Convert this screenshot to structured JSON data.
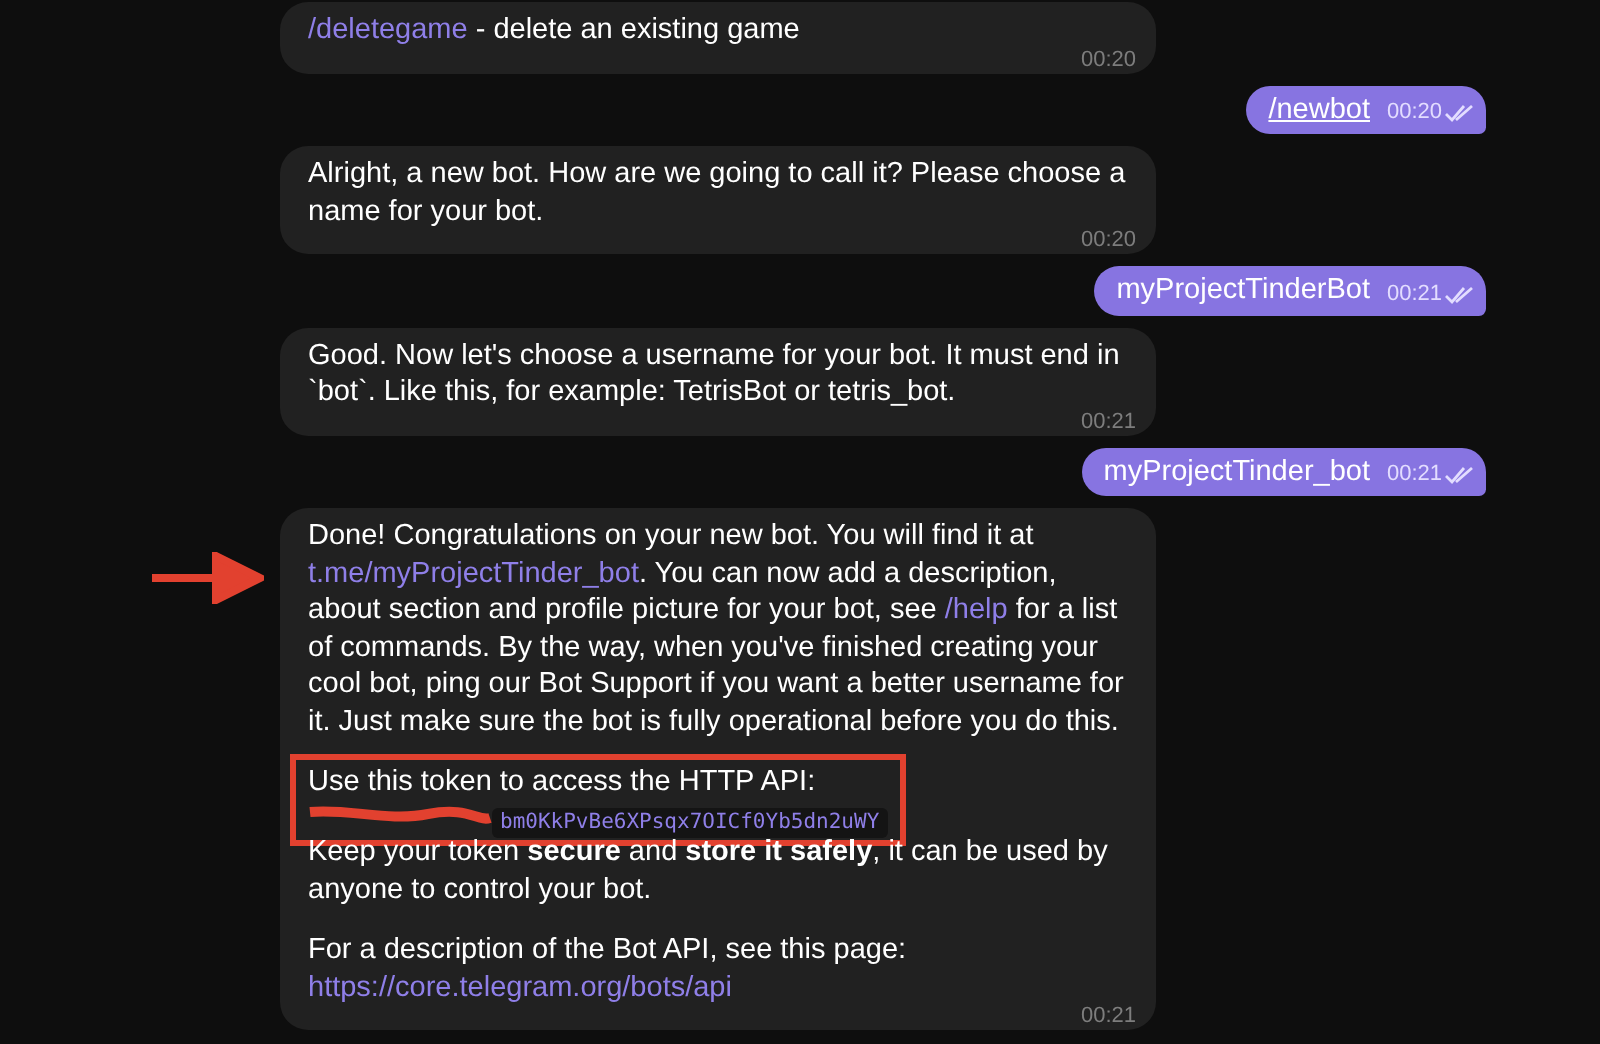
{
  "messages": [
    {
      "kind": "incoming",
      "time": "00:20",
      "paragraphs": [
        {
          "segments": [
            {
              "kind": "link",
              "text": "/deletegame"
            },
            {
              "kind": "text",
              "text": " - delete an existing game"
            }
          ]
        }
      ]
    },
    {
      "kind": "outgoing",
      "time": "00:20",
      "read": true,
      "paragraphs": [
        {
          "segments": [
            {
              "kind": "link",
              "text": "/newbot"
            }
          ]
        }
      ]
    },
    {
      "kind": "incoming",
      "time": "00:20",
      "paragraphs": [
        {
          "segments": [
            {
              "kind": "text",
              "text": "Alright, a new bot. How are we going to call it? Please choose a name for your bot."
            }
          ]
        }
      ]
    },
    {
      "kind": "outgoing",
      "time": "00:21",
      "read": true,
      "paragraphs": [
        {
          "segments": [
            {
              "kind": "text",
              "text": "myProjectTinderBot"
            }
          ]
        }
      ]
    },
    {
      "kind": "incoming",
      "time": "00:21",
      "paragraphs": [
        {
          "segments": [
            {
              "kind": "text",
              "text": "Good. Now let's choose a username for your bot. It must end in `bot`. Like this, for example: TetrisBot or tetris_bot."
            }
          ]
        }
      ]
    },
    {
      "kind": "outgoing",
      "time": "00:21",
      "read": true,
      "paragraphs": [
        {
          "segments": [
            {
              "kind": "text",
              "text": "myProjectTinder_bot"
            }
          ]
        }
      ]
    },
    {
      "kind": "incoming",
      "arrow": true,
      "time": "00:21",
      "paragraphs": [
        {
          "highlighted": false,
          "segments": [
            {
              "kind": "text",
              "text": "Done! Congratulations on your new bot. You will find it at "
            },
            {
              "kind": "link",
              "text": "t.me/myProjectTinder_bot"
            },
            {
              "kind": "text",
              "text": ". You can now add a description, about section and profile picture for your bot, see "
            },
            {
              "kind": "link",
              "text": "/help"
            },
            {
              "kind": "text",
              "text": " for a list of commands. By the way, when you've finished creating your cool bot, ping our Bot Support if you want a better username for it. Just make sure the bot is fully operational before you do this."
            }
          ]
        },
        {
          "highlighted": true,
          "segments": [
            {
              "kind": "text",
              "text": "Use this token to access the HTTP API:"
            },
            {
              "kind": "code",
              "redacted": true,
              "text": "bm0KkPvBe6XPsqx7OICf0Yb5dn2uWY"
            }
          ]
        },
        {
          "highlighted": false,
          "segments": [
            {
              "kind": "text",
              "text": "Keep your token **secure** and **store it safely**, it can be used by anyone to control your bot."
            }
          ]
        },
        {
          "highlighted": false,
          "segments": [
            {
              "kind": "text",
              "text": "For a description of the Bot API, see this page: "
            },
            {
              "kind": "link",
              "text": "https://core.telegram.org/bots/api"
            }
          ]
        }
      ]
    }
  ]
}
